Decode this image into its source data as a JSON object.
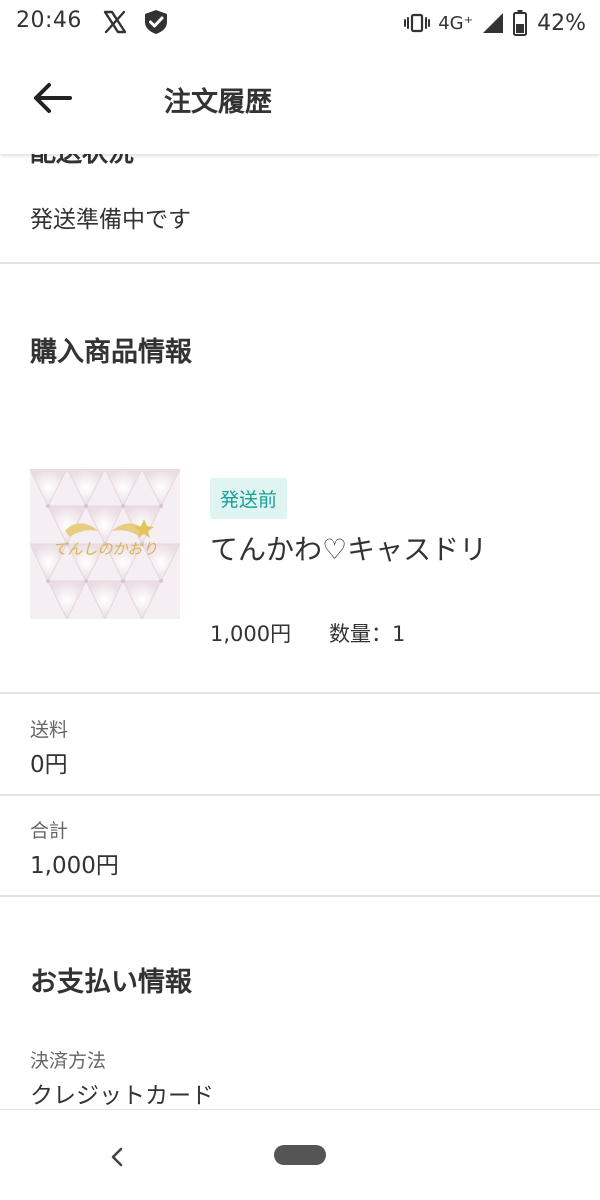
{
  "status_bar": {
    "time": "20:46",
    "network": "4G⁺",
    "battery": "42%",
    "icons": [
      "x-icon",
      "shield-icon",
      "vibrate-icon",
      "signal-icon",
      "battery-icon"
    ]
  },
  "header": {
    "title": "注文履歴",
    "back_icon": "arrow-left-icon"
  },
  "order": {
    "clipped_heading": "配送状況",
    "shipping_status": "発送準備中です",
    "items_heading": "購入商品情報",
    "item": {
      "badge": "発送前",
      "name": "てんかわ♡キャスドリ",
      "price": "1,000円",
      "quantity": "数量：1",
      "thumbnail_logo": "てんしのかおり"
    },
    "shipping_label": "送料",
    "shipping_value": "0円",
    "total_label": "合計",
    "total_value": "1,000円",
    "payment_heading": "お支払い情報",
    "payment_method_label": "決済方法",
    "payment_method_value": "クレジットカード"
  },
  "nav": {
    "back_icon": "chevron-left-icon",
    "home_icon": "home-pill-icon"
  },
  "colors": {
    "badge_bg": "#e0f4f2",
    "badge_text": "#1a9f95",
    "divider": "#e3e3e3",
    "thumbnail_bg": "#f5eef2",
    "logo_gold": "#d9b54f"
  }
}
